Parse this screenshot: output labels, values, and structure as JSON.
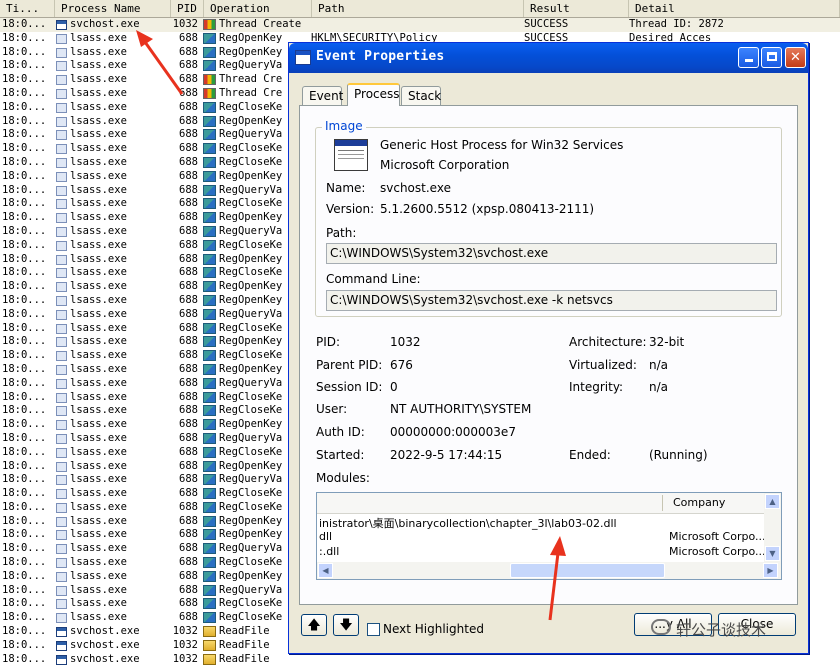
{
  "procmon": {
    "columns": [
      "Ti...",
      "Process Name",
      "PID",
      "Operation",
      "Path",
      "Result",
      "Detail"
    ],
    "rows": [
      {
        "time": "18:0...",
        "proc": "svchost.exe",
        "pid": "1032",
        "op": "Thread Create",
        "path": "",
        "result": "SUCCESS",
        "detail": "Thread ID: 2872",
        "pico": "exe",
        "oico": "thr"
      },
      {
        "time": "18:0...",
        "proc": "lsass.exe",
        "pid": "688",
        "op": "RegOpenKey",
        "path": "HKLM\\SECURITY\\Policy",
        "result": "SUCCESS",
        "detail": "Desired Acces",
        "pico": "lsass",
        "oico": "reg"
      },
      {
        "time": "18:0...",
        "proc": "lsass.exe",
        "pid": "688",
        "op": "RegOpenKey",
        "path": "",
        "result": "",
        "detail": "",
        "pico": "lsass",
        "oico": "reg"
      },
      {
        "time": "18:0...",
        "proc": "lsass.exe",
        "pid": "688",
        "op": "RegQueryVa",
        "path": "",
        "result": "",
        "detail": "",
        "pico": "lsass",
        "oico": "reg"
      },
      {
        "time": "18:0...",
        "proc": "lsass.exe",
        "pid": "688",
        "op": "Thread Cre",
        "path": "",
        "result": "",
        "detail": "",
        "pico": "lsass",
        "oico": "thr"
      },
      {
        "time": "18:0...",
        "proc": "lsass.exe",
        "pid": "688",
        "op": "Thread Cre",
        "path": "",
        "result": "",
        "detail": "",
        "pico": "lsass",
        "oico": "thr"
      },
      {
        "time": "18:0...",
        "proc": "lsass.exe",
        "pid": "688",
        "op": "RegCloseKe",
        "path": "",
        "result": "",
        "detail": "",
        "pico": "lsass",
        "oico": "reg"
      },
      {
        "time": "18:0...",
        "proc": "lsass.exe",
        "pid": "688",
        "op": "RegOpenKey",
        "path": "",
        "result": "",
        "detail": "",
        "pico": "lsass",
        "oico": "reg"
      },
      {
        "time": "18:0...",
        "proc": "lsass.exe",
        "pid": "688",
        "op": "RegQueryVa",
        "path": "",
        "result": "",
        "detail": "",
        "pico": "lsass",
        "oico": "reg"
      },
      {
        "time": "18:0...",
        "proc": "lsass.exe",
        "pid": "688",
        "op": "RegCloseKe",
        "path": "",
        "result": "",
        "detail": "",
        "pico": "lsass",
        "oico": "reg"
      },
      {
        "time": "18:0...",
        "proc": "lsass.exe",
        "pid": "688",
        "op": "RegCloseKe",
        "path": "",
        "result": "",
        "detail": "",
        "pico": "lsass",
        "oico": "reg"
      },
      {
        "time": "18:0...",
        "proc": "lsass.exe",
        "pid": "688",
        "op": "RegOpenKey",
        "path": "",
        "result": "",
        "detail": "",
        "pico": "lsass",
        "oico": "reg"
      },
      {
        "time": "18:0...",
        "proc": "lsass.exe",
        "pid": "688",
        "op": "RegQueryVa",
        "path": "",
        "result": "",
        "detail": "",
        "pico": "lsass",
        "oico": "reg"
      },
      {
        "time": "18:0...",
        "proc": "lsass.exe",
        "pid": "688",
        "op": "RegCloseKe",
        "path": "",
        "result": "",
        "detail": "",
        "pico": "lsass",
        "oico": "reg"
      },
      {
        "time": "18:0...",
        "proc": "lsass.exe",
        "pid": "688",
        "op": "RegOpenKey",
        "path": "",
        "result": "",
        "detail": "",
        "pico": "lsass",
        "oico": "reg"
      },
      {
        "time": "18:0...",
        "proc": "lsass.exe",
        "pid": "688",
        "op": "RegQueryVa",
        "path": "",
        "result": "",
        "detail": "",
        "pico": "lsass",
        "oico": "reg"
      },
      {
        "time": "18:0...",
        "proc": "lsass.exe",
        "pid": "688",
        "op": "RegCloseKe",
        "path": "",
        "result": "",
        "detail": "",
        "pico": "lsass",
        "oico": "reg"
      },
      {
        "time": "18:0...",
        "proc": "lsass.exe",
        "pid": "688",
        "op": "RegOpenKey",
        "path": "",
        "result": "",
        "detail": "",
        "pico": "lsass",
        "oico": "reg"
      },
      {
        "time": "18:0...",
        "proc": "lsass.exe",
        "pid": "688",
        "op": "RegCloseKe",
        "path": "",
        "result": "",
        "detail": "",
        "pico": "lsass",
        "oico": "reg"
      },
      {
        "time": "18:0...",
        "proc": "lsass.exe",
        "pid": "688",
        "op": "RegOpenKey",
        "path": "",
        "result": "",
        "detail": "",
        "pico": "lsass",
        "oico": "reg"
      },
      {
        "time": "18:0...",
        "proc": "lsass.exe",
        "pid": "688",
        "op": "RegOpenKey",
        "path": "",
        "result": "",
        "detail": "",
        "pico": "lsass",
        "oico": "reg"
      },
      {
        "time": "18:0...",
        "proc": "lsass.exe",
        "pid": "688",
        "op": "RegQueryVa",
        "path": "",
        "result": "",
        "detail": "",
        "pico": "lsass",
        "oico": "reg"
      },
      {
        "time": "18:0...",
        "proc": "lsass.exe",
        "pid": "688",
        "op": "RegCloseKe",
        "path": "",
        "result": "",
        "detail": "",
        "pico": "lsass",
        "oico": "reg"
      },
      {
        "time": "18:0...",
        "proc": "lsass.exe",
        "pid": "688",
        "op": "RegOpenKey",
        "path": "",
        "result": "",
        "detail": "",
        "pico": "lsass",
        "oico": "reg"
      },
      {
        "time": "18:0...",
        "proc": "lsass.exe",
        "pid": "688",
        "op": "RegCloseKe",
        "path": "",
        "result": "",
        "detail": "",
        "pico": "lsass",
        "oico": "reg"
      },
      {
        "time": "18:0...",
        "proc": "lsass.exe",
        "pid": "688",
        "op": "RegOpenKey",
        "path": "",
        "result": "",
        "detail": "",
        "pico": "lsass",
        "oico": "reg"
      },
      {
        "time": "18:0...",
        "proc": "lsass.exe",
        "pid": "688",
        "op": "RegQueryVa",
        "path": "",
        "result": "",
        "detail": "",
        "pico": "lsass",
        "oico": "reg"
      },
      {
        "time": "18:0...",
        "proc": "lsass.exe",
        "pid": "688",
        "op": "RegCloseKe",
        "path": "",
        "result": "",
        "detail": "",
        "pico": "lsass",
        "oico": "reg"
      },
      {
        "time": "18:0...",
        "proc": "lsass.exe",
        "pid": "688",
        "op": "RegCloseKe",
        "path": "",
        "result": "",
        "detail": "",
        "pico": "lsass",
        "oico": "reg"
      },
      {
        "time": "18:0...",
        "proc": "lsass.exe",
        "pid": "688",
        "op": "RegOpenKey",
        "path": "",
        "result": "",
        "detail": "",
        "pico": "lsass",
        "oico": "reg"
      },
      {
        "time": "18:0...",
        "proc": "lsass.exe",
        "pid": "688",
        "op": "RegQueryVa",
        "path": "",
        "result": "",
        "detail": "",
        "pico": "lsass",
        "oico": "reg"
      },
      {
        "time": "18:0...",
        "proc": "lsass.exe",
        "pid": "688",
        "op": "RegCloseKe",
        "path": "",
        "result": "",
        "detail": "",
        "pico": "lsass",
        "oico": "reg"
      },
      {
        "time": "18:0...",
        "proc": "lsass.exe",
        "pid": "688",
        "op": "RegOpenKey",
        "path": "",
        "result": "",
        "detail": "",
        "pico": "lsass",
        "oico": "reg"
      },
      {
        "time": "18:0...",
        "proc": "lsass.exe",
        "pid": "688",
        "op": "RegQueryVa",
        "path": "",
        "result": "",
        "detail": "",
        "pico": "lsass",
        "oico": "reg"
      },
      {
        "time": "18:0...",
        "proc": "lsass.exe",
        "pid": "688",
        "op": "RegCloseKe",
        "path": "",
        "result": "",
        "detail": "",
        "pico": "lsass",
        "oico": "reg"
      },
      {
        "time": "18:0...",
        "proc": "lsass.exe",
        "pid": "688",
        "op": "RegCloseKe",
        "path": "",
        "result": "",
        "detail": "",
        "pico": "lsass",
        "oico": "reg"
      },
      {
        "time": "18:0...",
        "proc": "lsass.exe",
        "pid": "688",
        "op": "RegOpenKey",
        "path": "",
        "result": "",
        "detail": "",
        "pico": "lsass",
        "oico": "reg"
      },
      {
        "time": "18:0...",
        "proc": "lsass.exe",
        "pid": "688",
        "op": "RegOpenKey",
        "path": "",
        "result": "",
        "detail": "",
        "pico": "lsass",
        "oico": "reg"
      },
      {
        "time": "18:0...",
        "proc": "lsass.exe",
        "pid": "688",
        "op": "RegQueryVa",
        "path": "",
        "result": "",
        "detail": "",
        "pico": "lsass",
        "oico": "reg"
      },
      {
        "time": "18:0...",
        "proc": "lsass.exe",
        "pid": "688",
        "op": "RegCloseKe",
        "path": "",
        "result": "",
        "detail": "",
        "pico": "lsass",
        "oico": "reg"
      },
      {
        "time": "18:0...",
        "proc": "lsass.exe",
        "pid": "688",
        "op": "RegOpenKey",
        "path": "",
        "result": "",
        "detail": "",
        "pico": "lsass",
        "oico": "reg"
      },
      {
        "time": "18:0...",
        "proc": "lsass.exe",
        "pid": "688",
        "op": "RegQueryVa",
        "path": "",
        "result": "",
        "detail": "",
        "pico": "lsass",
        "oico": "reg"
      },
      {
        "time": "18:0...",
        "proc": "lsass.exe",
        "pid": "688",
        "op": "RegCloseKe",
        "path": "",
        "result": "",
        "detail": "",
        "pico": "lsass",
        "oico": "reg"
      },
      {
        "time": "18:0...",
        "proc": "lsass.exe",
        "pid": "688",
        "op": "RegCloseKe",
        "path": "",
        "result": "",
        "detail": "",
        "pico": "lsass",
        "oico": "reg"
      },
      {
        "time": "18:0...",
        "proc": "svchost.exe",
        "pid": "1032",
        "op": "ReadFile",
        "path": "",
        "result": "",
        "detail": "",
        "pico": "exe",
        "oico": "file"
      },
      {
        "time": "18:0...",
        "proc": "svchost.exe",
        "pid": "1032",
        "op": "ReadFile",
        "path": "",
        "result": "",
        "detail": "",
        "pico": "exe",
        "oico": "file"
      },
      {
        "time": "18:0...",
        "proc": "svchost.exe",
        "pid": "1032",
        "op": "ReadFile",
        "path": "",
        "result": "",
        "detail": "",
        "pico": "exe",
        "oico": "file"
      }
    ]
  },
  "dialog": {
    "title": "Event Properties",
    "tabs": [
      "Event",
      "Process",
      "Stack"
    ],
    "active_tab": "Process",
    "image_group_label": "Image",
    "description": "Generic Host Process for Win32 Services",
    "company": "Microsoft Corporation",
    "name_label": "Name:",
    "name_value": "svchost.exe",
    "version_label": "Version:",
    "version_value": "5.1.2600.5512 (xpsp.080413-2111)",
    "path_label": "Path:",
    "path_value": "C:\\WINDOWS\\System32\\svchost.exe",
    "cmdline_label": "Command Line:",
    "cmdline_value": "C:\\WINDOWS\\System32\\svchost.exe -k netsvcs",
    "left_fields": [
      {
        "label": "PID:",
        "value": "1032"
      },
      {
        "label": "Parent PID:",
        "value": "676"
      },
      {
        "label": "Session ID:",
        "value": "0"
      },
      {
        "label": "User:",
        "value": "NT AUTHORITY\\SYSTEM"
      },
      {
        "label": "Auth ID:",
        "value": "00000000:000003e7"
      },
      {
        "label": "Started:",
        "value": "2022-9-5 17:44:15"
      }
    ],
    "right_fields": [
      {
        "label": "Architecture:",
        "value": "32-bit"
      },
      {
        "label": "Virtualized:",
        "value": "n/a"
      },
      {
        "label": "Integrity:",
        "value": "n/a"
      },
      {
        "label": "Ended:",
        "value": "(Running)"
      }
    ],
    "modules_label": "Modules:",
    "modules_header_company": "Company",
    "modules": [
      {
        "path": "inistrator\\桌面\\binarycollection\\chapter_3l\\lab03-02.dll",
        "company": ""
      },
      {
        "path": "dll",
        "company": "Microsoft Corpo..."
      },
      {
        "path": ":.dll",
        "company": "Microsoft Corpo..."
      }
    ],
    "next_highlighted_label": "Next Highlighted",
    "ok_label": "...y All",
    "close_label": "Close",
    "up_arrow": "🡅",
    "down_arrow": "🡇"
  },
  "watermark": "轩公子谈技术",
  "colors": {
    "arrow": "#e8321e",
    "selection": "#f1efe2",
    "xp_blue": "#0450d9"
  }
}
